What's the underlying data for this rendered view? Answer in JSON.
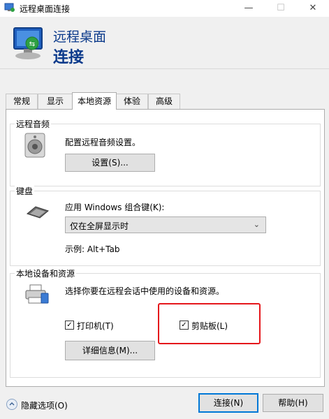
{
  "window": {
    "title": "远程桌面连接",
    "icon": "rdp-app-icon",
    "controls": {
      "minimize": "—",
      "maximize": "☐",
      "close": "✕"
    }
  },
  "header": {
    "line1": "远程桌面",
    "line2": "连接"
  },
  "tabs": [
    {
      "label": "常规"
    },
    {
      "label": "显示"
    },
    {
      "label": "本地资源",
      "active": true
    },
    {
      "label": "体验"
    },
    {
      "label": "高级"
    }
  ],
  "remote_audio": {
    "group_label": "远程音频",
    "description": "配置远程音频设置。",
    "settings_button": "设置(S)..."
  },
  "keyboard": {
    "group_label": "键盘",
    "apply_label": "应用 Windows 组合键(K):",
    "selected_option": "仅在全屏显示时",
    "example": "示例: Alt+Tab"
  },
  "local_devices": {
    "group_label": "本地设备和资源",
    "description": "选择你要在远程会话中使用的设备和资源。",
    "printers_label": "打印机(T)",
    "printers_checked": true,
    "clipboard_label": "剪贴板(L)",
    "clipboard_checked": true,
    "details_button": "详细信息(M)..."
  },
  "footer": {
    "hide_options": "隐藏选项(O)",
    "connect_button": "连接(N)",
    "help_button": "帮助(H)"
  },
  "colors": {
    "accent": "#0078d7",
    "highlight": "#e5161b",
    "header_text": "#0b3a8b"
  }
}
